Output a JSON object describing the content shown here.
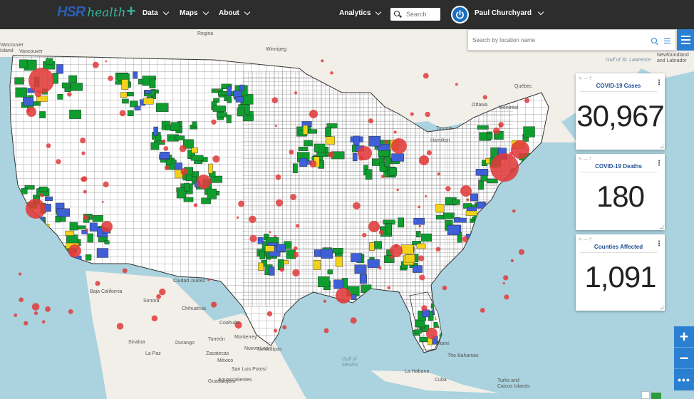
{
  "brand": {
    "name_part1": "HSR",
    "name_part2": "health",
    "plus": "+"
  },
  "nav": {
    "data": "Data",
    "maps": "Maps",
    "about": "About",
    "analytics": "Analytics",
    "search_placeholder": "Search",
    "user": "Paul Churchyard"
  },
  "location_search": {
    "placeholder": "Search by location name"
  },
  "cards": [
    {
      "title": "COVID-19 Cases",
      "value": "30,967"
    },
    {
      "title": "COVID-19 Deaths",
      "value": "180"
    },
    {
      "title": "Counties Affected",
      "value": "1,091"
    }
  ],
  "map_labels": {
    "regina": "Regina",
    "winnipeg": "Winnipeg",
    "vancouver_island": "Vancouver\nIsland",
    "vancouver": "Vancouver",
    "quebec": "Québec",
    "ottawa": "Ottawa",
    "toronto": "Toronto",
    "hamilton": "Hamilton",
    "montreal": "Montréal",
    "newfoundland": "Newfoundland\nand Labrador",
    "gulf": "Gulf of St. Lawrence",
    "baja": "Baja California",
    "sonora": "Sonora",
    "chihuahua": "Chihuahua",
    "ciudad_juarez": "Ciudad Juárez",
    "coahuila": "Coahuila",
    "monterrey": "Monterrey",
    "torreon": "Torreón",
    "nuevo_leon": "Nuevo León",
    "tamaulipas": "Tamaulipas",
    "sinaloa": "Sinaloa",
    "durango": "Durango",
    "la_paz": "La Paz",
    "zacatecas": "Zacatecas",
    "san_luis": "San Luis Potosí",
    "mexico": "México",
    "guadalajara": "Guadalajara",
    "aguascalientes": "Aguascalientes",
    "bahamas": "The Bahamas",
    "la_habana": "La Habana",
    "cuba": "Cuba",
    "turks": "Turks and\nCaicos Islands",
    "miami": "Miami",
    "gulf_mexico": "Gulf of\nMexico"
  },
  "colors": {
    "county_green": "#0f9d2f",
    "county_blue": "#3f5fd6",
    "county_yellow": "#f2d21b",
    "case_dot": "#e03a3a",
    "nav_bg": "#2d2d2d",
    "accent": "#2a7fd0"
  },
  "controls": {
    "zoom_in": "+",
    "zoom_out": "−",
    "more": "•••"
  }
}
